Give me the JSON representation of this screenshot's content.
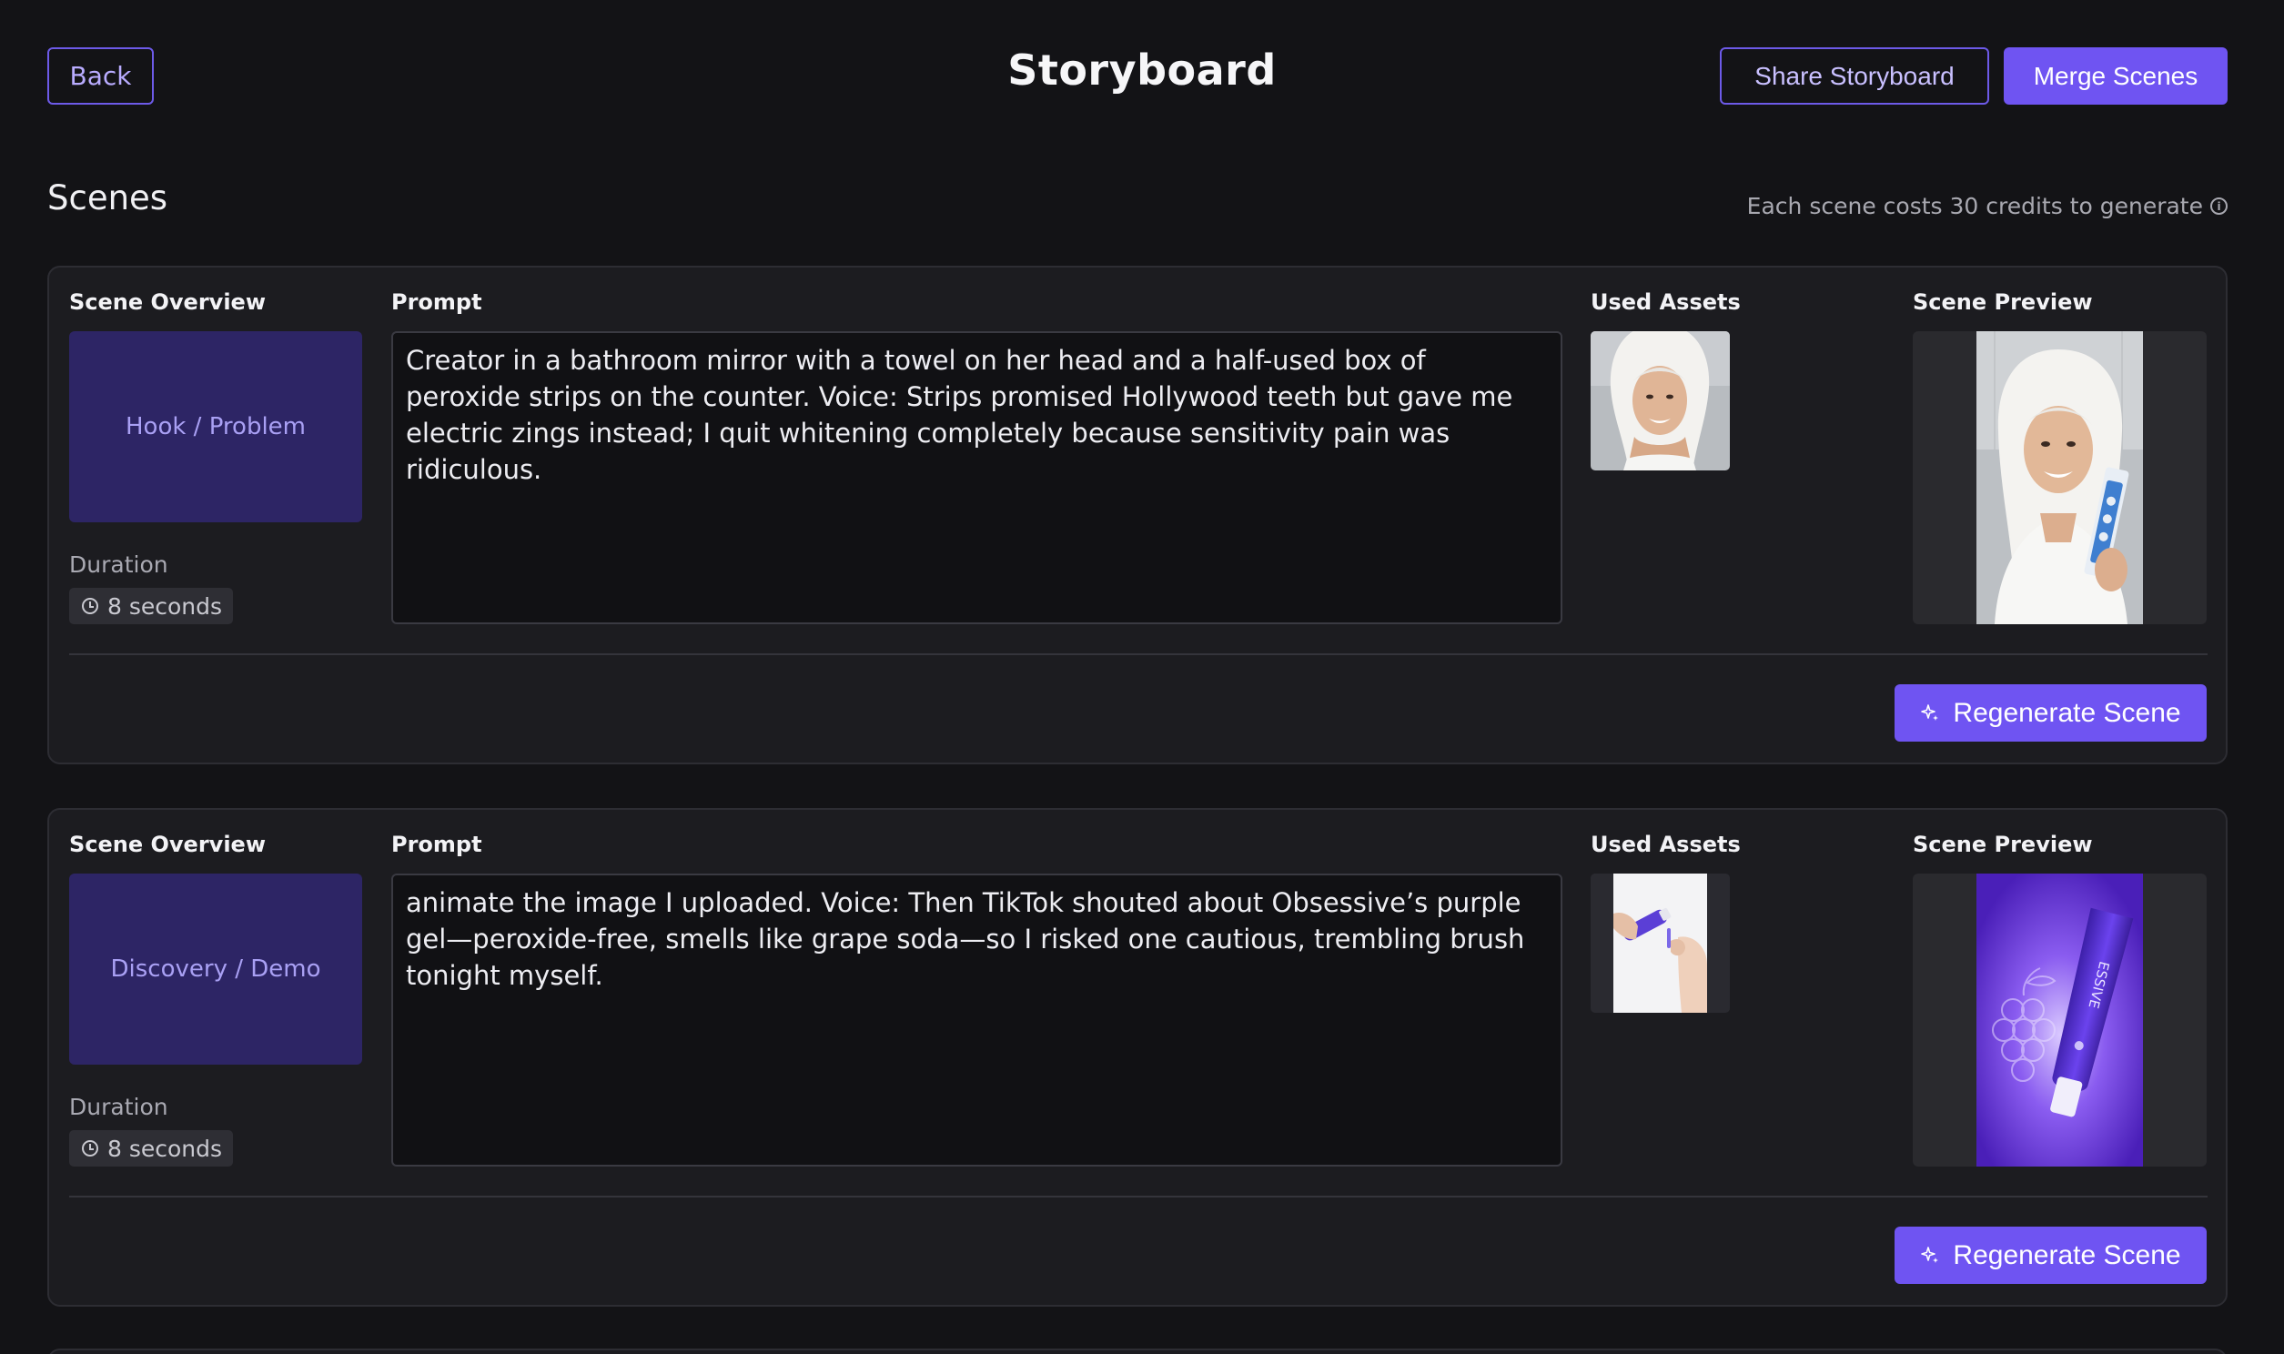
{
  "header": {
    "back_label": "Back",
    "title": "Storyboard",
    "share_label": "Share Storyboard",
    "merge_label": "Merge Scenes"
  },
  "section": {
    "title": "Scenes",
    "cost_note": "Each scene costs 30 credits to generate",
    "cost_note_icon": "info-icon"
  },
  "columns": {
    "overview": "Scene Overview",
    "prompt": "Prompt",
    "assets": "Used Assets",
    "preview": "Scene Preview"
  },
  "scenes": [
    {
      "overview": "Hook / Problem",
      "duration_label": "Duration",
      "duration": "8 seconds",
      "prompt": "Creator in a bathroom mirror with a towel on her head and a half-used box of peroxide strips on the counter. Voice: Strips promised Hollywood teeth but gave me electric zings instead; I quit whitening completely because sensitivity pain was ridiculous.",
      "regenerate_label": "Regenerate Scene"
    },
    {
      "overview": "Discovery / Demo",
      "duration_label": "Duration",
      "duration": "8 seconds",
      "prompt": "animate the image I uploaded. Voice: Then TikTok shouted about Obsessive’s purple gel—peroxide-free, smells like grape soda—so I risked one cautious, trembling brush tonight myself.",
      "regenerate_label": "Regenerate Scene"
    }
  ],
  "preview_tube_text": "ESSIVE",
  "colors": {
    "background": "#131316",
    "card": "#1c1c20",
    "accent": "#6f54f2",
    "overview_tile": "#2d2565"
  }
}
